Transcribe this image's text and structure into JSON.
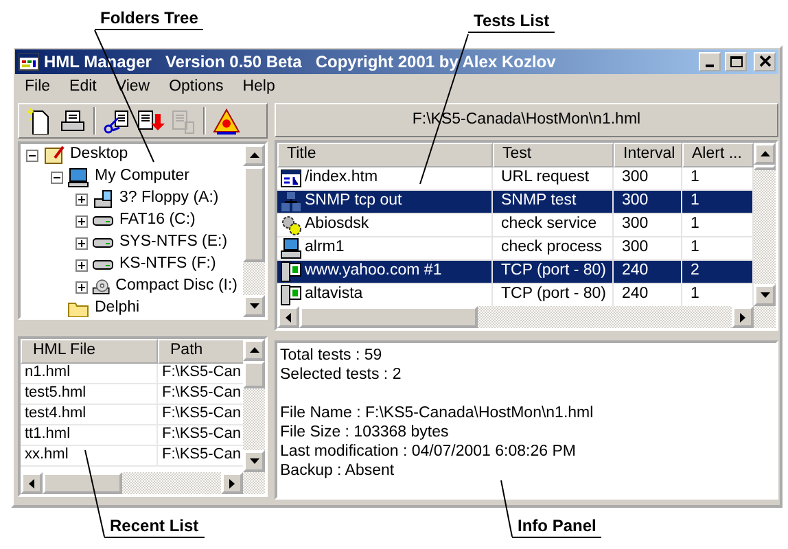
{
  "callouts": [
    {
      "label": "Folders Tree"
    },
    {
      "label": "Tests List"
    },
    {
      "label": "Recent List"
    },
    {
      "label": "Info Panel"
    }
  ],
  "window": {
    "title": "HML Manager   Version 0.50 Beta   Copyright 2001 by Alex Kozlov"
  },
  "menu": [
    "File",
    "Edit",
    "View",
    "Options",
    "Help"
  ],
  "toolbar": [
    {
      "kind": "new",
      "disabled": false
    },
    {
      "kind": "print",
      "disabled": false
    },
    {
      "kind": "find",
      "disabled": false
    },
    {
      "kind": "import",
      "disabled": false
    },
    {
      "kind": "export",
      "disabled": true
    },
    {
      "kind": "alert",
      "disabled": false
    }
  ],
  "tree": [
    {
      "label": "Desktop",
      "kind": "desktop",
      "has_children": true,
      "expanded": true,
      "children": [
        {
          "label": "My Computer",
          "kind": "computer",
          "has_children": true,
          "expanded": true,
          "children": [
            {
              "label": "3? Floppy (A:)",
              "kind": "floppy",
              "has_children": true,
              "expanded": false
            },
            {
              "label": "FAT16 (C:)",
              "kind": "drive",
              "has_children": true,
              "expanded": false
            },
            {
              "label": "SYS-NTFS (E:)",
              "kind": "drive",
              "has_children": true,
              "expanded": false
            },
            {
              "label": "KS-NTFS (F:)",
              "kind": "drive",
              "has_children": true,
              "expanded": false
            },
            {
              "label": "Compact Disc (I:)",
              "kind": "cd",
              "has_children": true,
              "expanded": false
            }
          ]
        },
        {
          "label": "Delphi",
          "kind": "folder",
          "has_children": false,
          "expanded": false
        }
      ]
    }
  ],
  "recent": {
    "columns": [
      "HML File",
      "Path"
    ],
    "rows": [
      [
        "n1.hml",
        "F:\\KS5-Can"
      ],
      [
        "test5.hml",
        "F:\\KS5-Can"
      ],
      [
        "test4.hml",
        "F:\\KS5-Can"
      ],
      [
        "tt1.hml",
        "F:\\KS5-Can"
      ],
      [
        "xx.hml",
        "F:\\KS5-Can"
      ]
    ]
  },
  "path_header": "F:\\KS5-Canada\\HostMon\\n1.hml",
  "tests": {
    "columns": [
      "Title",
      "Test",
      "Interval",
      "Alert ..."
    ],
    "rows": [
      {
        "kind": "url",
        "cells": [
          "/index.htm",
          "URL request",
          "300",
          "1"
        ],
        "selected": false
      },
      {
        "kind": "snmp",
        "cells": [
          "SNMP tcp out",
          "SNMP test",
          "300",
          "1"
        ],
        "selected": true
      },
      {
        "kind": "service",
        "cells": [
          "Abiosdsk",
          "check service",
          "300",
          "1"
        ],
        "selected": false
      },
      {
        "kind": "process",
        "cells": [
          "alrm1",
          "check process",
          "300",
          "1"
        ],
        "selected": false
      },
      {
        "kind": "tcp",
        "cells": [
          "www.yahoo.com #1",
          "TCP (port - 80)",
          "240",
          "2"
        ],
        "selected": true
      },
      {
        "kind": "tcp",
        "cells": [
          "altavista",
          "TCP (port - 80)",
          "240",
          "1"
        ],
        "selected": false
      }
    ]
  },
  "info": [
    [
      "Total tests : 59",
      "Selected tests : 2"
    ],
    [
      "File Name : F:\\KS5-Canada\\HostMon\\n1.hml",
      "File Size : 103368 bytes",
      "Last modification : 04/07/2001 6:08:26 PM",
      "Backup : Absent"
    ]
  ]
}
